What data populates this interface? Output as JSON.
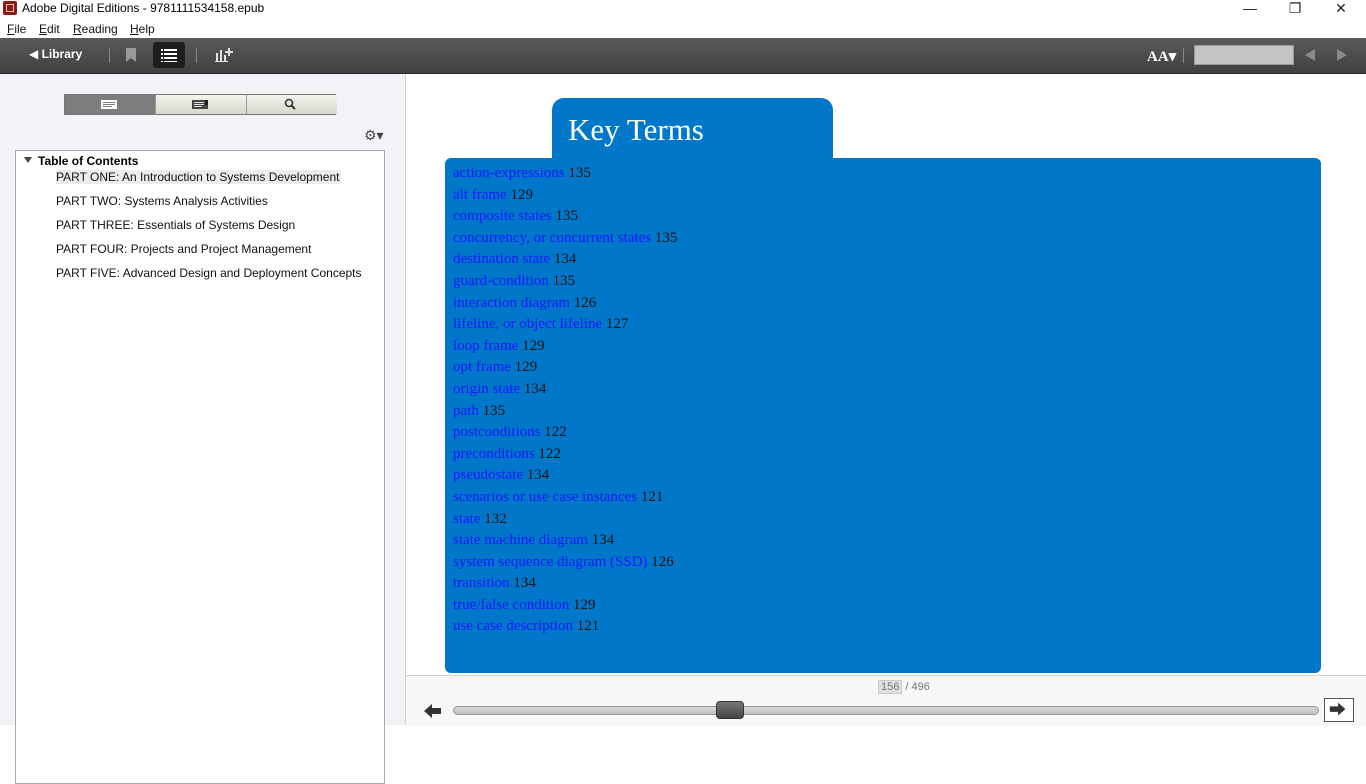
{
  "window": {
    "title": "Adobe Digital Editions - 9781111534158.epub",
    "minimize_glyph": "—",
    "maximize_glyph": "❐",
    "close_glyph": "✕"
  },
  "menu": {
    "items": [
      {
        "mnemonic": "F",
        "rest": "ile"
      },
      {
        "mnemonic": "E",
        "rest": "dit"
      },
      {
        "mnemonic": "R",
        "rest": "eading"
      },
      {
        "mnemonic": "H",
        "rest": "elp"
      }
    ]
  },
  "toolbar": {
    "library_label": "◀ Library",
    "font_size_label": "AA▾",
    "icons": [
      "bookmark-icon",
      "list-view-icon",
      "add-stats-icon",
      "font-size-icon",
      "previous-page-icon",
      "next-page-icon"
    ]
  },
  "sidebar": {
    "tabs": [
      "toc-view-icon",
      "bookmarks-view-icon",
      "search-icon"
    ],
    "gear_glyph": "⚙▾",
    "toc_root": "Table of Contents",
    "toc_items": [
      "PART ONE: An Introduction to Systems Development",
      "PART TWO: Systems Analysis Activities",
      "PART THREE: Essentials of Systems Design",
      "PART FOUR: Projects and Project Management",
      "PART FIVE: Advanced Design and Deployment Concepts"
    ]
  },
  "content": {
    "heading": "Key Terms",
    "accent_color": "#0077c8",
    "link_color": "#1818ff",
    "terms": [
      {
        "term": "action-expressions",
        "page": "135"
      },
      {
        "term": "alt frame",
        "page": "129"
      },
      {
        "term": "composite states",
        "page": "135"
      },
      {
        "term": "concurrency, or concurrent states",
        "page": "135"
      },
      {
        "term": "destination state",
        "page": "134"
      },
      {
        "term": "guard-condition",
        "page": "135"
      },
      {
        "term": "interaction diagram",
        "page": "126"
      },
      {
        "term": "lifeline, or object lifeline",
        "page": "127"
      },
      {
        "term": "loop frame",
        "page": "129"
      },
      {
        "term": "opt frame",
        "page": "129"
      },
      {
        "term": "origin state",
        "page": "134"
      },
      {
        "term": "path",
        "page": "135"
      },
      {
        "term": "postconditions",
        "page": "122"
      },
      {
        "term": "preconditions",
        "page": "122"
      },
      {
        "term": "pseudostate",
        "page": "134"
      },
      {
        "term": "scenarios or use case instances",
        "page": "121"
      },
      {
        "term": "state",
        "page": "132"
      },
      {
        "term": "state machine diagram",
        "page": "134"
      },
      {
        "term": "system sequence diagram (SSD)",
        "page": "126"
      },
      {
        "term": "transition",
        "page": "134"
      },
      {
        "term": "true/false condition",
        "page": "129"
      },
      {
        "term": "use case description",
        "page": "121"
      }
    ]
  },
  "pagination": {
    "current": "156",
    "total_label": "/ 496",
    "current_page": 156,
    "total_pages": 496
  }
}
